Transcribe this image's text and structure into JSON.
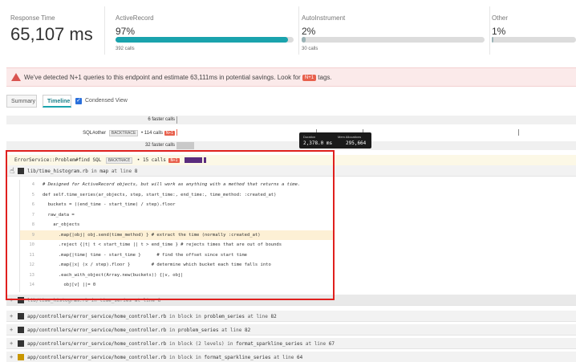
{
  "metrics": {
    "response": {
      "label": "Response Time",
      "value": "65,107 ms"
    },
    "active_record": {
      "label": "ActiveRecord",
      "value": "97%",
      "calls": "392 calls",
      "fraction": 0.97
    },
    "autoinstrument": {
      "label": "AutoInstrument",
      "value": "2%",
      "calls": "30 calls",
      "fraction": 0.02
    },
    "other": {
      "label": "Other",
      "value": "1%",
      "fraction": 0.01
    }
  },
  "alert": {
    "text_before": "We've detected N+1 queries to this endpoint and estimate 63,111ms in potential savings. Look for",
    "tag": "N+1",
    "text_after": "tags."
  },
  "tabs": {
    "summary": "Summary",
    "timeline": "Timeline",
    "condensed": "Condensed View",
    "check_mark": "✓"
  },
  "timeline": {
    "faster_top": "6 faster calls",
    "sql_other": {
      "name": "SQL#other",
      "tag": "BACKTRACE",
      "calls": "• 114 calls",
      "nplus": "N+1"
    },
    "faster_mid": "32 faster calls",
    "error_service": {
      "name": "ErrorService::Problem#find",
      "sql": "SQL",
      "tag": "BACKTRACE",
      "calls": "• 15 calls",
      "nplus": "N+1"
    }
  },
  "tooltip": {
    "duration_label": "Duration",
    "duration_value": "2,378.0 ms",
    "alloc_label": "Mem Allocations",
    "alloc_value": "295,664"
  },
  "trace": {
    "main_file": {
      "path": "lib/time_histogram.rb",
      "in": "in",
      "method": "map",
      "at": "at line",
      "line": "8"
    },
    "code_lines": [
      {
        "n": "4",
        "text": "# Designed for ActiveRecord objects, but will work as anything with a method that returns a time."
      },
      {
        "n": "5",
        "text": "def self.time_series(ar_objects, step, start_time:, end_time:, time_method: :created_at)"
      },
      {
        "n": "6",
        "text": "  buckets = ((end_time - start_time) / step).floor"
      },
      {
        "n": "7",
        "text": "  raw_data ="
      },
      {
        "n": "8",
        "text": "    ar_objects"
      },
      {
        "n": "9",
        "text": "      .map{|obj| obj.send(time_method) } # extract the time (normally :created_at)"
      },
      {
        "n": "10",
        "text": "      .reject {|t| t < start_time || t > end_time } # rejects times that are out of bounds"
      },
      {
        "n": "11",
        "text": "      .map{|time| time - start_time }      # find the offset since start time"
      },
      {
        "n": "12",
        "text": "      .map{|x| (x / step).floor }        # determine which bucket each time falls into"
      },
      {
        "n": "13",
        "text": "      .each_with_object(Array.new(buckets)) {|v, obj|"
      },
      {
        "n": "14",
        "text": "        obj[v] ||= 0"
      }
    ],
    "hidden_row": {
      "path": "lib/time_histogram.rb",
      "in": "in",
      "method": "time_series",
      "at": "at line",
      "line": "8"
    },
    "stack": [
      {
        "path": "app/controllers/error_service/home_controller.rb",
        "in": "in",
        "context": "block in",
        "method": "problem_series",
        "at": "at line",
        "line": "82"
      },
      {
        "path": "app/controllers/error_service/home_controller.rb",
        "in": "in",
        "context": "",
        "method": "problem_series",
        "at": "at line",
        "line": "82"
      },
      {
        "path": "app/controllers/error_service/home_controller.rb",
        "in": "in",
        "context": "block (2 levels) in",
        "method": "format_sparkline_series",
        "at": "at line",
        "line": "67"
      },
      {
        "path": "app/controllers/error_service/home_controller.rb",
        "in": "in",
        "context": "block in",
        "method": "format_sparkline_series",
        "at": "at line",
        "line": "64"
      }
    ]
  }
}
